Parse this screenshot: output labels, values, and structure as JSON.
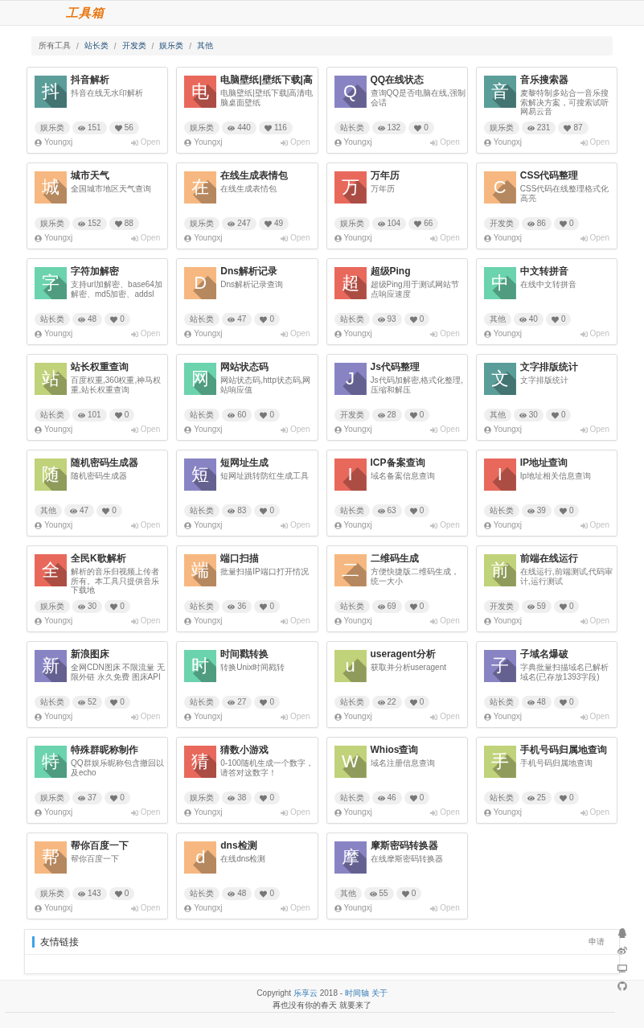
{
  "header": {
    "logo": "工具箱"
  },
  "breadcrumb": [
    {
      "label": "所有工具",
      "selected": true
    },
    {
      "separator": "/",
      "label": "站长类",
      "selected": false
    },
    {
      "separator": "/",
      "label": "开发类",
      "selected": false
    },
    {
      "separator": "/",
      "label": "娱乐类",
      "selected": false
    },
    {
      "separator": "/",
      "label": "其他",
      "selected": false
    }
  ],
  "tools": [
    {
      "initial": "抖",
      "color": "#5b9d99",
      "title": "抖音解析",
      "description": "抖音在线无水印解析",
      "category": "娱乐类",
      "views": "151",
      "likes": "56",
      "author": "Youngxj",
      "action": "Open"
    },
    {
      "initial": "电",
      "color": "#e8695c",
      "title": "电脑壁纸|壁纸下载|高",
      "description": "电脑壁纸|壁纸下载|高清电脑桌面壁纸",
      "category": "娱乐类",
      "views": "440",
      "likes": "116",
      "author": "Youngxj",
      "action": "Open"
    },
    {
      "initial": "Q",
      "color": "#8884c4",
      "title": "QQ在线状态",
      "description": "查询QQ是否电脑在线,强制会话",
      "category": "站长类",
      "views": "132",
      "likes": "0",
      "author": "Youngxj",
      "action": "Open"
    },
    {
      "initial": "音",
      "color": "#5b9d99",
      "title": "音乐搜索器",
      "description": "麦黎特制多站合一音乐搜索解决方案，可搜索试听网易云音",
      "category": "娱乐类",
      "views": "231",
      "likes": "87",
      "author": "Youngxj",
      "action": "Open"
    },
    {
      "initial": "城",
      "color": "#f6b880",
      "title": "城市天气",
      "description": "全国城市地区天气查询",
      "category": "娱乐类",
      "views": "152",
      "likes": "88",
      "author": "Youngxj",
      "action": "Open"
    },
    {
      "initial": "在",
      "color": "#f6b880",
      "title": "在线生成表情包",
      "description": "在线生成表情包",
      "category": "娱乐类",
      "views": "247",
      "likes": "49",
      "author": "Youngxj",
      "action": "Open"
    },
    {
      "initial": "万",
      "color": "#e8695c",
      "title": "万年历",
      "description": "万年历",
      "category": "娱乐类",
      "views": "104",
      "likes": "66",
      "author": "Youngxj",
      "action": "Open"
    },
    {
      "initial": "C",
      "color": "#f6b880",
      "title": "CSS代码整理",
      "description": "CSS代码在线整理格式化高亮",
      "category": "开发类",
      "views": "86",
      "likes": "0",
      "author": "Youngxj",
      "action": "Open"
    },
    {
      "initial": "字",
      "color": "#6bd3ad",
      "title": "字符加解密",
      "description": "支持url加解密、base64加解密、md5加密、addsl",
      "category": "站长类",
      "views": "48",
      "likes": "0",
      "author": "Youngxj",
      "action": "Open"
    },
    {
      "initial": "D",
      "color": "#f6b880",
      "title": "Dns解析记录",
      "description": "Dns解析记录查询",
      "category": "站长类",
      "views": "47",
      "likes": "0",
      "author": "Youngxj",
      "action": "Open"
    },
    {
      "initial": "超",
      "color": "#e8695c",
      "title": "超级Ping",
      "description": "超级Ping用于测试网站节点响应速度",
      "category": "站长类",
      "views": "93",
      "likes": "0",
      "author": "Youngxj",
      "action": "Open"
    },
    {
      "initial": "中",
      "color": "#6bd3ad",
      "title": "中文转拼音",
      "description": "在线中文转拼音",
      "category": "其他",
      "views": "40",
      "likes": "0",
      "author": "Youngxj",
      "action": "Open"
    },
    {
      "initial": "站",
      "color": "#c0d27a",
      "title": "站长权重查询",
      "description": "百度权重,360权重,神马权重,站长权重查询",
      "category": "站长类",
      "views": "101",
      "likes": "0",
      "author": "Youngxj",
      "action": "Open"
    },
    {
      "initial": "网",
      "color": "#6bd3ad",
      "title": "网站状态码",
      "description": "网站状态码,http状态码,网站响应值",
      "category": "站长类",
      "views": "60",
      "likes": "0",
      "author": "Youngxj",
      "action": "Open"
    },
    {
      "initial": "J",
      "color": "#8884c4",
      "title": "Js代码整理",
      "description": "Js代码加解密,格式化整理,压缩和解压",
      "category": "开发类",
      "views": "28",
      "likes": "0",
      "author": "Youngxj",
      "action": "Open"
    },
    {
      "initial": "文",
      "color": "#5b9d99",
      "title": "文字排版统计",
      "description": "文字排版统计",
      "category": "其他",
      "views": "30",
      "likes": "0",
      "author": "Youngxj",
      "action": "Open"
    },
    {
      "initial": "随",
      "color": "#c0d27a",
      "title": "随机密码生成器",
      "description": "随机密码生成器",
      "category": "其他",
      "views": "47",
      "likes": "0",
      "author": "Youngxj",
      "action": "Open"
    },
    {
      "initial": "短",
      "color": "#8884c4",
      "title": "短网址生成",
      "description": "短网址跳转防红生成工具",
      "category": "站长类",
      "views": "83",
      "likes": "0",
      "author": "Youngxj",
      "action": "Open"
    },
    {
      "initial": "I",
      "color": "#e8695c",
      "title": "ICP备案查询",
      "description": "域名备案信息查询",
      "category": "站长类",
      "views": "63",
      "likes": "0",
      "author": "Youngxj",
      "action": "Open"
    },
    {
      "initial": "I",
      "color": "#e8695c",
      "title": "IP地址查询",
      "description": "Ip地址相关信息查询",
      "category": "站长类",
      "views": "39",
      "likes": "0",
      "author": "Youngxj",
      "action": "Open"
    },
    {
      "initial": "全",
      "color": "#e8695c",
      "title": "全民K歌解析",
      "description": "解析的音乐归视频上传者所有。本工具只提供音乐下载地",
      "category": "娱乐类",
      "views": "30",
      "likes": "0",
      "author": "Youngxj",
      "action": "Open"
    },
    {
      "initial": "端",
      "color": "#f6b880",
      "title": "端口扫描",
      "description": "批量扫描IP端口打开情况",
      "category": "站长类",
      "views": "36",
      "likes": "0",
      "author": "Youngxj",
      "action": "Open"
    },
    {
      "initial": "二",
      "color": "#f6b880",
      "title": "二维码生成",
      "description": "方便快捷版二维码生成，统一大小",
      "category": "站长类",
      "views": "69",
      "likes": "0",
      "author": "Youngxj",
      "action": "Open"
    },
    {
      "initial": "前",
      "color": "#c0d27a",
      "title": "前端在线运行",
      "description": "在线运行,前端测试,代码审计,运行测试",
      "category": "开发类",
      "views": "59",
      "likes": "0",
      "author": "Youngxj",
      "action": "Open"
    },
    {
      "initial": "新",
      "color": "#8884c4",
      "title": "新浪图床",
      "description": "全网CDN图床 不限流量 无限外链 永久免费 图床API",
      "category": "站长类",
      "views": "52",
      "likes": "0",
      "author": "Youngxj",
      "action": "Open"
    },
    {
      "initial": "时",
      "color": "#6bd3ad",
      "title": "时间戳转换",
      "description": "转换Unix时间戳转",
      "category": "站长类",
      "views": "27",
      "likes": "0",
      "author": "Youngxj",
      "action": "Open"
    },
    {
      "initial": "u",
      "color": "#c0d27a",
      "title": "useragent分析",
      "description": "获取并分析useragent",
      "category": "站长类",
      "views": "22",
      "likes": "0",
      "author": "Youngxj",
      "action": "Open"
    },
    {
      "initial": "子",
      "color": "#8884c4",
      "title": "子域名爆破",
      "description": "字典批量扫描域名已解析域名(已存放1393字段)",
      "category": "站长类",
      "views": "48",
      "likes": "0",
      "author": "Youngxj",
      "action": "Open"
    },
    {
      "initial": "特",
      "color": "#6bd3ad",
      "title": "特殊群昵称制作",
      "description": "QQ群娱乐昵称包含撤回以及echo",
      "category": "娱乐类",
      "views": "37",
      "likes": "0",
      "author": "Youngxj",
      "action": "Open"
    },
    {
      "initial": "猜",
      "color": "#e8695c",
      "title": "猜数小游戏",
      "description": "0-100随机生成一个数字，请答对这数字！",
      "category": "娱乐类",
      "views": "38",
      "likes": "0",
      "author": "Youngxj",
      "action": "Open"
    },
    {
      "initial": "W",
      "color": "#c0d27a",
      "title": "Whios查询",
      "description": "域名注册信息查询",
      "category": "站长类",
      "views": "46",
      "likes": "0",
      "author": "Youngxj",
      "action": "Open"
    },
    {
      "initial": "手",
      "color": "#c0d27a",
      "title": "手机号码归属地查询",
      "description": "手机号码归属地查询",
      "category": "站长类",
      "views": "25",
      "likes": "0",
      "author": "Youngxj",
      "action": "Open"
    },
    {
      "initial": "帮",
      "color": "#f6b880",
      "title": "帮你百度一下",
      "description": "帮你百度一下",
      "category": "娱乐类",
      "views": "143",
      "likes": "0",
      "author": "Youngxj",
      "action": "Open"
    },
    {
      "initial": "d",
      "color": "#f6b880",
      "title": "dns检测",
      "description": "在线dns检测",
      "category": "站长类",
      "views": "48",
      "likes": "0",
      "author": "Youngxj",
      "action": "Open"
    },
    {
      "initial": "摩",
      "color": "#8884c4",
      "title": "摩斯密码转换器",
      "description": "在线摩斯密码转换器",
      "category": "其他",
      "views": "55",
      "likes": "0",
      "author": "Youngxj",
      "action": "Open"
    }
  ],
  "friend_links": {
    "title": "友情链接",
    "apply": "申请"
  },
  "footer": {
    "copyright": {
      "prefix": "Copyright",
      "site": "乐享云",
      "year": "2018 -",
      "links": [
        "时间轴",
        "关于"
      ]
    },
    "slogan": "再也没有你的春天 就要来了"
  }
}
